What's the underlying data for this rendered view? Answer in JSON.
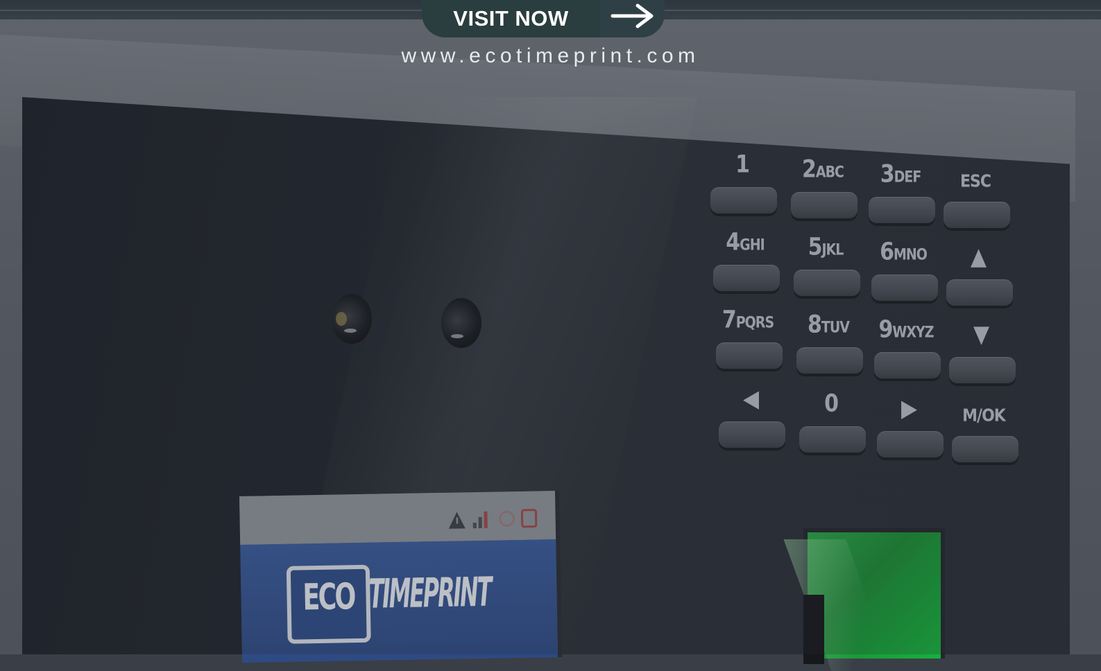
{
  "cta": {
    "label": "VISIT NOW",
    "arrow_icon": "arrow-right-icon"
  },
  "website": "www.ecotimeprint.com",
  "keypad": {
    "keys": [
      {
        "id": "1",
        "main": "1",
        "sub": ""
      },
      {
        "id": "2",
        "main": "2",
        "sub": "ABC"
      },
      {
        "id": "3",
        "main": "3",
        "sub": "DEF"
      },
      {
        "id": "esc",
        "main": "ESC",
        "sub": ""
      },
      {
        "id": "4",
        "main": "4",
        "sub": "GHI"
      },
      {
        "id": "5",
        "main": "5",
        "sub": "JKL"
      },
      {
        "id": "6",
        "main": "6",
        "sub": "MNO"
      },
      {
        "id": "up",
        "main": "▲",
        "sub": ""
      },
      {
        "id": "7",
        "main": "7",
        "sub": "PQRS"
      },
      {
        "id": "8",
        "main": "8",
        "sub": "TUV"
      },
      {
        "id": "9",
        "main": "9",
        "sub": "WXYZ"
      },
      {
        "id": "down",
        "main": "▼",
        "sub": ""
      },
      {
        "id": "left",
        "main": "◀",
        "sub": ""
      },
      {
        "id": "0",
        "main": "0",
        "sub": ""
      },
      {
        "id": "right",
        "main": "▶",
        "sub": ""
      },
      {
        "id": "mok",
        "main": "M/OK",
        "sub": ""
      }
    ]
  },
  "screen": {
    "logo_left": "ECO",
    "logo_right": "TIMEPRINT"
  },
  "colors": {
    "cta_bg": "#2a3d3f",
    "fingerprint_sensor": "#1fa63f",
    "panel": "#22262d"
  }
}
